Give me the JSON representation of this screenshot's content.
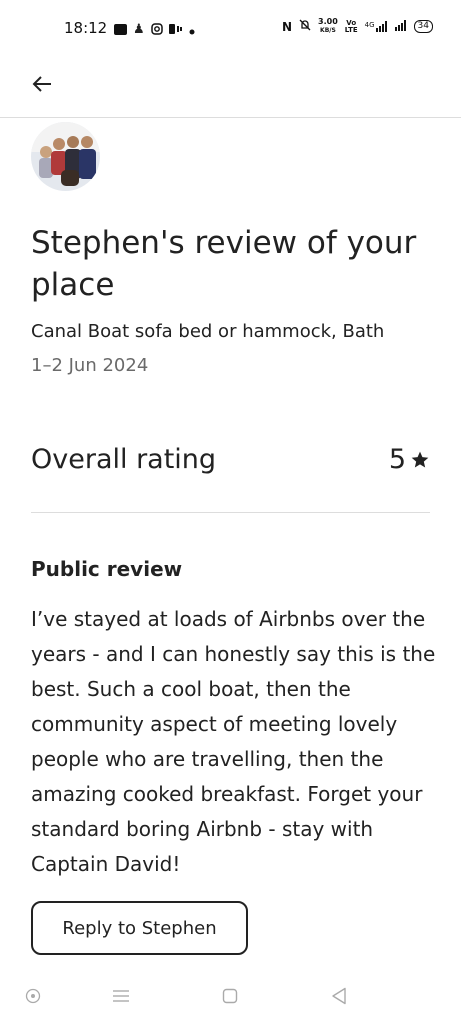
{
  "status_bar": {
    "time": "18:12",
    "net_speed_top": "3.00",
    "net_speed_bottom": "KB/S",
    "network": "4G",
    "battery": "34"
  },
  "header": {
    "back_icon": "arrow-left-icon"
  },
  "review": {
    "title": "Stephen's review of your place",
    "listing": "Canal Boat sofa bed or hammock, Bath",
    "dates": "1–2 Jun 2024",
    "rating_label": "Overall rating",
    "rating_value": "5",
    "rating_icon": "star-icon",
    "public_review_label": "Public review",
    "public_review_text": "I’ve stayed at loads of Airbnbs over the years - and I can honestly say this is the best. Such a cool boat, then the community aspect of meeting lovely people who are travelling, then the amazing cooked breakfast. Forget your standard boring Airbnb - stay with Captain David!",
    "reply_button": "Reply to Stephen"
  },
  "nav_bar": {
    "icons": [
      "recent-apps-icon",
      "menu-icon",
      "home-icon",
      "back-icon"
    ]
  },
  "colors": {
    "text": "#222222",
    "muted": "#6a6a6a",
    "divider": "#dddddd"
  }
}
